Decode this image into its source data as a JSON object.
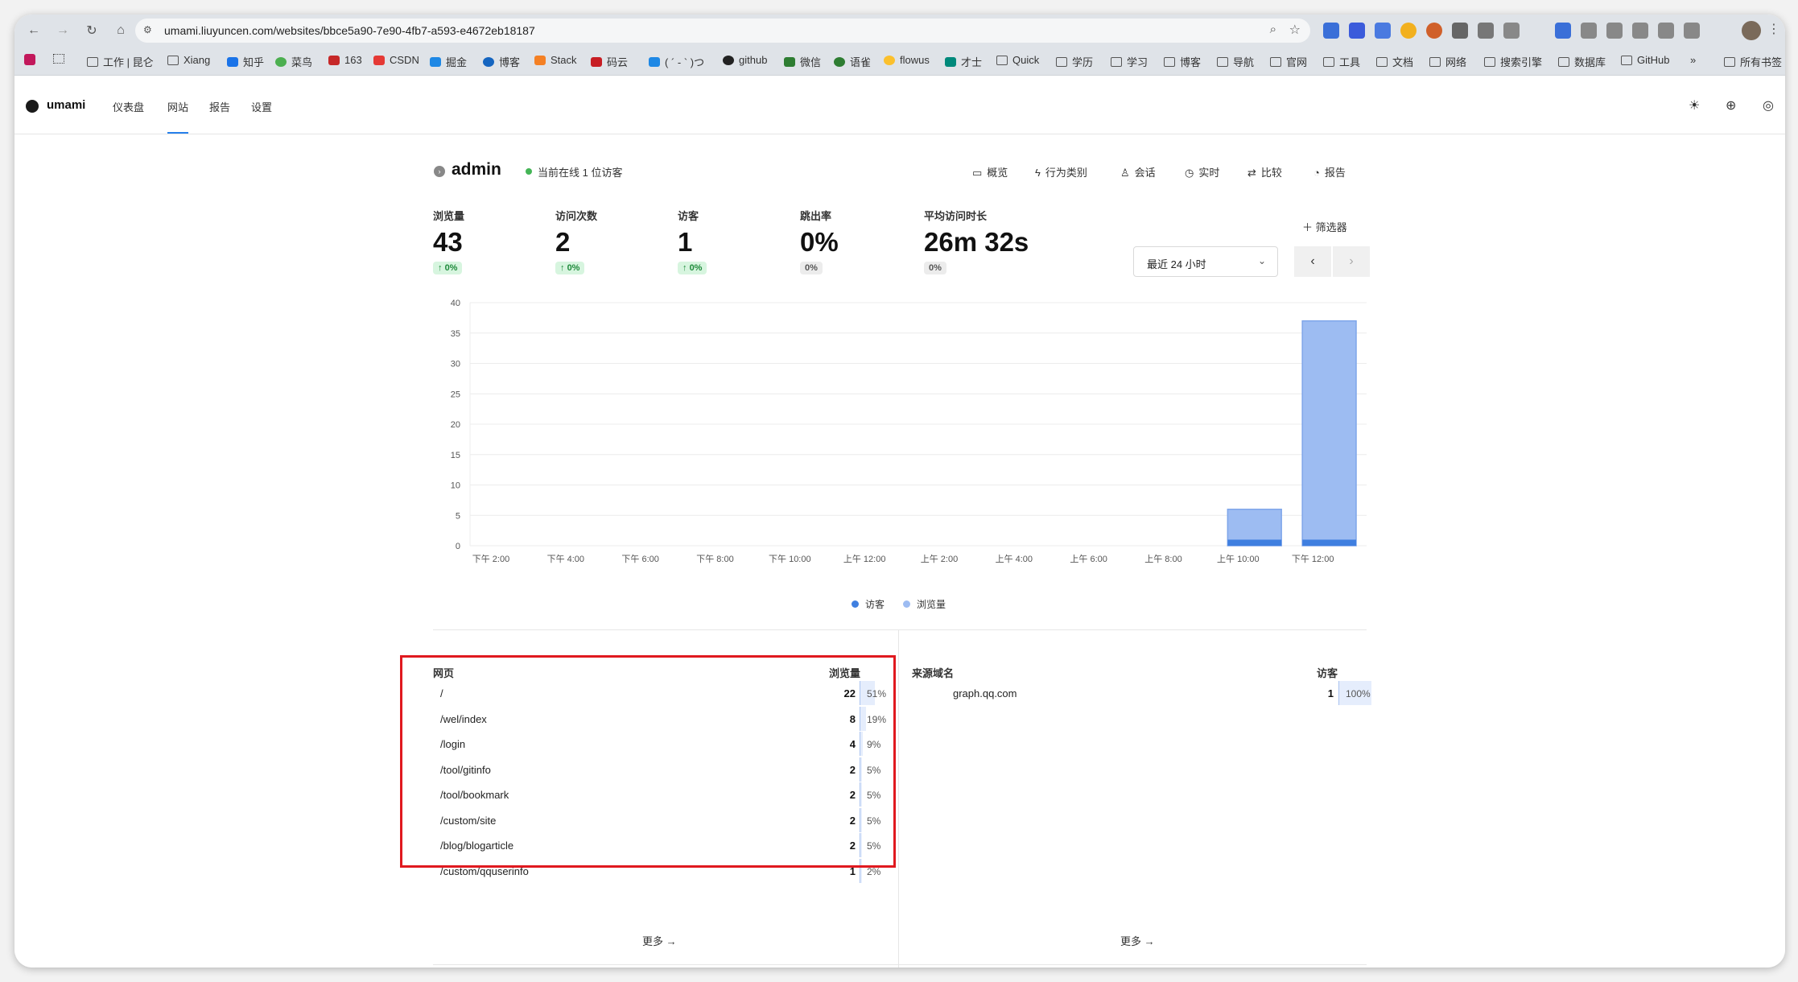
{
  "browser": {
    "url": "umami.liuyuncen.com/websites/bbce5a90-7e90-4fb7-a593-e4672eb18187",
    "bookmarks": [
      "H",
      "工作 | 昆仑",
      "Xiang",
      "知乎",
      "菜鸟",
      "163",
      "CSDN",
      "掘金",
      "博客",
      "Stack",
      "码云",
      "( ´ - ` )つ",
      "github",
      "微信",
      "语雀",
      "flowus",
      "才士",
      "Quick",
      "学历",
      "学习",
      "博客",
      "导航",
      "官网",
      "工具",
      "文档",
      "网络",
      "搜索引擎",
      "数据库",
      "GitHub",
      "所有书签"
    ]
  },
  "app": {
    "name": "umami",
    "nav": [
      "仪表盘",
      "网站",
      "报告",
      "设置"
    ]
  },
  "site": {
    "name": "admin",
    "online": "当前在线 1 位访客"
  },
  "tabs": [
    "概览",
    "行为类别",
    "会话",
    "实时",
    "比较",
    "报告"
  ],
  "metrics": [
    {
      "label": "浏览量",
      "value": "43",
      "change": "0%",
      "trend": "up"
    },
    {
      "label": "访问次数",
      "value": "2",
      "change": "0%",
      "trend": "up"
    },
    {
      "label": "访客",
      "value": "1",
      "change": "0%",
      "trend": "up"
    },
    {
      "label": "跳出率",
      "value": "0%",
      "change": "0%",
      "trend": "flat"
    },
    {
      "label": "平均访问时长",
      "value": "26m 32s",
      "change": "0%",
      "trend": "flat"
    }
  ],
  "controls": {
    "filter": "筛选器",
    "range": "最近 24 小时"
  },
  "chart_data": {
    "type": "bar",
    "categories": [
      "下午 2:00",
      "下午 4:00",
      "下午 6:00",
      "下午 8:00",
      "下午 10:00",
      "上午 12:00",
      "上午 2:00",
      "上午 4:00",
      "上午 6:00",
      "上午 8:00",
      "上午 10:00",
      "下午 12:00"
    ],
    "series": [
      {
        "name": "访客",
        "values": [
          0,
          0,
          0,
          0,
          0,
          0,
          0,
          0,
          0,
          0,
          1,
          1
        ]
      },
      {
        "name": "浏览量",
        "values": [
          0,
          0,
          0,
          0,
          0,
          0,
          0,
          0,
          0,
          0,
          6,
          37
        ]
      }
    ],
    "yticks": [
      0,
      5,
      10,
      15,
      20,
      25,
      30,
      35,
      40
    ],
    "ylim": [
      0,
      40
    ],
    "grid": true,
    "legend": "bottom",
    "colors": {
      "visitors": "#3f7fe0",
      "views": "#9dbcf2"
    }
  },
  "pages_table": {
    "header": {
      "name": "网页",
      "metric": "浏览量"
    },
    "rows": [
      {
        "path": "/",
        "count": "22",
        "pct": "51%",
        "frac": 0.51
      },
      {
        "path": "/wel/index",
        "count": "8",
        "pct": "19%",
        "frac": 0.19
      },
      {
        "path": "/login",
        "count": "4",
        "pct": "9%",
        "frac": 0.09
      },
      {
        "path": "/tool/gitinfo",
        "count": "2",
        "pct": "5%",
        "frac": 0.05
      },
      {
        "path": "/tool/bookmark",
        "count": "2",
        "pct": "5%",
        "frac": 0.05
      },
      {
        "path": "/custom/site",
        "count": "2",
        "pct": "5%",
        "frac": 0.05
      },
      {
        "path": "/blog/blogarticle",
        "count": "2",
        "pct": "5%",
        "frac": 0.05
      },
      {
        "path": "/custom/qquserinfo",
        "count": "1",
        "pct": "2%",
        "frac": 0.02
      }
    ],
    "more": "更多 →"
  },
  "referrers_table": {
    "header": {
      "name": "来源域名",
      "metric": "访客"
    },
    "rows": [
      {
        "path": "graph.qq.com",
        "count": "1",
        "pct": "100%",
        "frac": 1.0
      }
    ],
    "more": "更多 →"
  }
}
